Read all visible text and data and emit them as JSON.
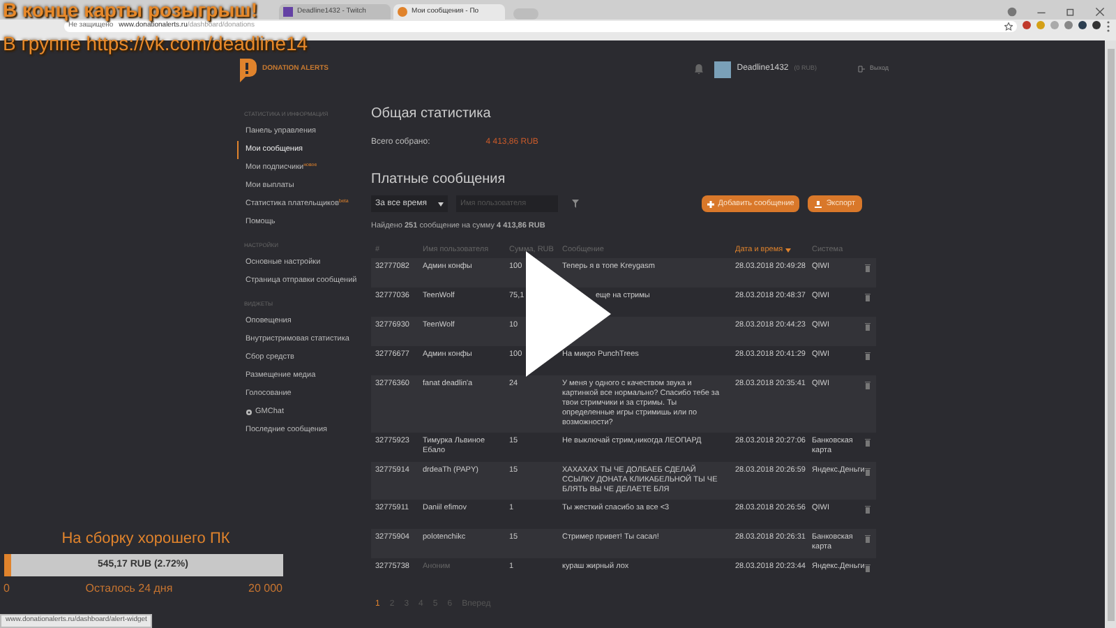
{
  "overlay": {
    "headline": "В конце карты розыгрыш!",
    "group_note": "В группе https://vk.com/deadline14"
  },
  "browser": {
    "tabs": [
      {
        "title": "Deadline1432 - Twitch",
        "selected": false,
        "kind": "twitch"
      },
      {
        "title": "Мои сообщения - По",
        "selected": true,
        "kind": "site"
      }
    ],
    "security": "Не защищено",
    "url_host": "www.donationalerts.ru",
    "url_path": "/dashboard/donations"
  },
  "header": {
    "logo": "DONATION ALERTS",
    "user": "Deadline1432",
    "balance": "(0 RUB)",
    "logout": "Выход"
  },
  "sidebar": [
    {
      "title": "СТАТИСТИКА И ИНФОРМАЦИЯ",
      "items": [
        {
          "label": "Панель управления",
          "selected": false
        },
        {
          "label": "Мои сообщения",
          "selected": true
        },
        {
          "label": "Мои подписчики",
          "selected": false,
          "badge": "новое"
        },
        {
          "label": "Мои выплаты",
          "selected": false
        },
        {
          "label": "Статистика плательщиков",
          "selected": false,
          "badge": "beta"
        },
        {
          "label": "Помощь",
          "selected": false
        }
      ]
    },
    {
      "title": "НАСТРОЙКИ",
      "items": [
        {
          "label": "Основные настройки",
          "selected": false
        },
        {
          "label": "Страница отправки сообщений",
          "selected": false
        }
      ]
    },
    {
      "title": "ВИДЖЕТЫ",
      "items": [
        {
          "label": "Оповещения",
          "selected": false
        },
        {
          "label": "Внутристримовая статистика",
          "selected": false
        },
        {
          "label": "Сбор средств",
          "selected": false
        },
        {
          "label": "Размещение медиа",
          "selected": false
        },
        {
          "label": "Голосование",
          "selected": false
        },
        {
          "label": "GMChat",
          "selected": false,
          "kind": "gear"
        },
        {
          "label": "Последние сообщения",
          "selected": false
        }
      ]
    }
  ],
  "stats": {
    "title": "Общая статистика",
    "label": "Всего собрано:",
    "value": "4 413,86 RUB"
  },
  "paid": {
    "title": "Платные сообщения",
    "period": "За все время",
    "search_placeholder": "Имя пользователя",
    "add_button": "Добавить сообщение",
    "export_button": "Экспорт",
    "found": "Найдено **251** сообщение на сумму **4 413,86 RUB**"
  },
  "table": {
    "columns": [
      {
        "label": "#",
        "sorted": false
      },
      {
        "label": "Имя пользователя",
        "sorted": false
      },
      {
        "label": "Сумма, RUB",
        "sorted": false
      },
      {
        "label": "Сообщение",
        "sorted": false
      },
      {
        "label": "Дата и время",
        "sorted": true
      },
      {
        "label": "Система",
        "sorted": false
      }
    ],
    "rows": [
      {
        "id": "32777082",
        "user": "Админ конфы",
        "anonymous": false,
        "sum": "100",
        "message": "Теперь я в топе Kreygasm",
        "date": "28.03.2018 20:49:28",
        "system": "QIWI"
      },
      {
        "id": "32777036",
        "user": "TeenWolf",
        "anonymous": false,
        "sum": "75,1",
        "message": "еще на стримы",
        "kind": "covered",
        "date": "28.03.2018 20:48:37",
        "system": "QIWI"
      },
      {
        "id": "32776930",
        "user": "TeenWolf",
        "anonymous": false,
        "sum": "10",
        "date": "28.03.2018 20:44:23",
        "system": "QIWI"
      },
      {
        "id": "32776677",
        "user": "Админ конфы",
        "anonymous": false,
        "sum": "100",
        "message": "На микро PunchTrees",
        "date": "28.03.2018 20:41:29",
        "system": "QIWI"
      },
      {
        "id": "32776360",
        "user": "fanat deadlin'a",
        "anonymous": false,
        "sum": "24",
        "message": "У меня у одного с качеством звука и картинкой все нормально? Спасибо тебе за твои стримчики и за стримы. Ты определенные игры стримишь или по возможности?",
        "date": "28.03.2018 20:35:41",
        "system": "QIWI"
      },
      {
        "id": "32775923",
        "user": "Тимурка Львиное Ебало",
        "anonymous": false,
        "sum": "15",
        "message": "Не выключай стрим,никогда ЛЕОПАРД",
        "date": "28.03.2018 20:27:06",
        "system": "Банковская карта"
      },
      {
        "id": "32775914",
        "user": "drdeaTh (PAPY)",
        "anonymous": false,
        "sum": "15",
        "message": "ХАХАХАХ ТЫ ЧЕ ДОЛБАЕБ СДЕЛАЙ ССЫЛКУ ДОНАТА КЛИКАБЕЛЬНОЙ ТЫ ЧЕ БЛЯТЬ ВЫ ЧЕ ДЕЛАЕТЕ БЛЯ",
        "date": "28.03.2018 20:26:59",
        "system": "Яндекс.Деньги"
      },
      {
        "id": "32775911",
        "user": "Daniil efimov",
        "anonymous": false,
        "sum": "1",
        "message": "Ты жесткий спасибо за все <3",
        "date": "28.03.2018 20:26:56",
        "system": "QIWI"
      },
      {
        "id": "32775904",
        "user": "polotenchikc",
        "anonymous": false,
        "sum": "15",
        "message": "Стример привет! Ты сасал!",
        "date": "28.03.2018 20:26:31",
        "system": "Банковская карта"
      },
      {
        "id": "32775738",
        "user": "Аноним",
        "anonymous": true,
        "sum": "1",
        "message": "кураш жирный лох",
        "date": "28.03.2018 20:23:44",
        "system": "Яндекс.Деньги"
      }
    ]
  },
  "pagination": {
    "pages": [
      {
        "label": "1",
        "selected": true
      },
      {
        "label": "2",
        "selected": false
      },
      {
        "label": "3",
        "selected": false
      },
      {
        "label": "4",
        "selected": false
      },
      {
        "label": "5",
        "selected": false
      },
      {
        "label": "6",
        "selected": false
      }
    ],
    "next": "Вперед"
  },
  "goal": {
    "title": "На сборку хорошего ПК",
    "reading": "545,17 RUB (2.72%)",
    "level": 0.0272,
    "min": "0",
    "remaining": "Осталось 24 дня",
    "max": "20 000"
  },
  "status_url": "www.donationalerts.ru/dashboard/alert-widget"
}
